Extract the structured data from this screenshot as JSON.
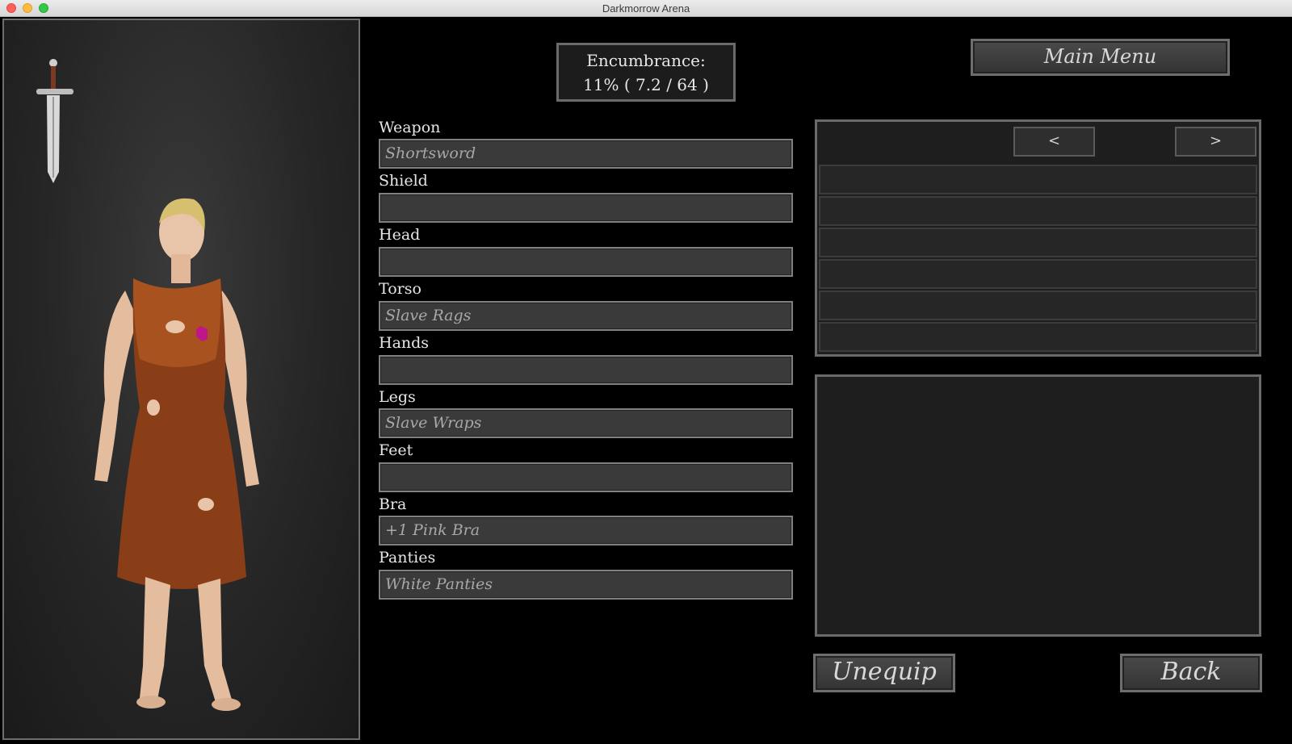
{
  "window": {
    "title": "Darkmorrow Arena"
  },
  "encumbrance": {
    "label": "Encumbrance:",
    "value": "11% ( 7.2 / 64 )"
  },
  "main_menu_label": "Main Menu",
  "slots": [
    {
      "label": "Weapon",
      "value": "Shortsword"
    },
    {
      "label": "Shield",
      "value": ""
    },
    {
      "label": "Head",
      "value": ""
    },
    {
      "label": "Torso",
      "value": "Slave Rags"
    },
    {
      "label": "Hands",
      "value": ""
    },
    {
      "label": "Legs",
      "value": "Slave Wraps"
    },
    {
      "label": "Feet",
      "value": ""
    },
    {
      "label": "Bra",
      "value": "+1 Pink Bra"
    },
    {
      "label": "Panties",
      "value": "White Panties"
    }
  ],
  "inventory": {
    "prev_label": "<",
    "next_label": ">",
    "rows": [
      "",
      "",
      "",
      "",
      "",
      ""
    ]
  },
  "description": "",
  "buttons": {
    "unequip": "Unequip",
    "back": "Back"
  },
  "colors": {
    "background": "#000000",
    "field": "#3a3a3a",
    "border": "#808080",
    "text": "#e6e6e6",
    "value_text": "#a8a8a8"
  },
  "icons": {
    "weapon": "sword-icon"
  }
}
